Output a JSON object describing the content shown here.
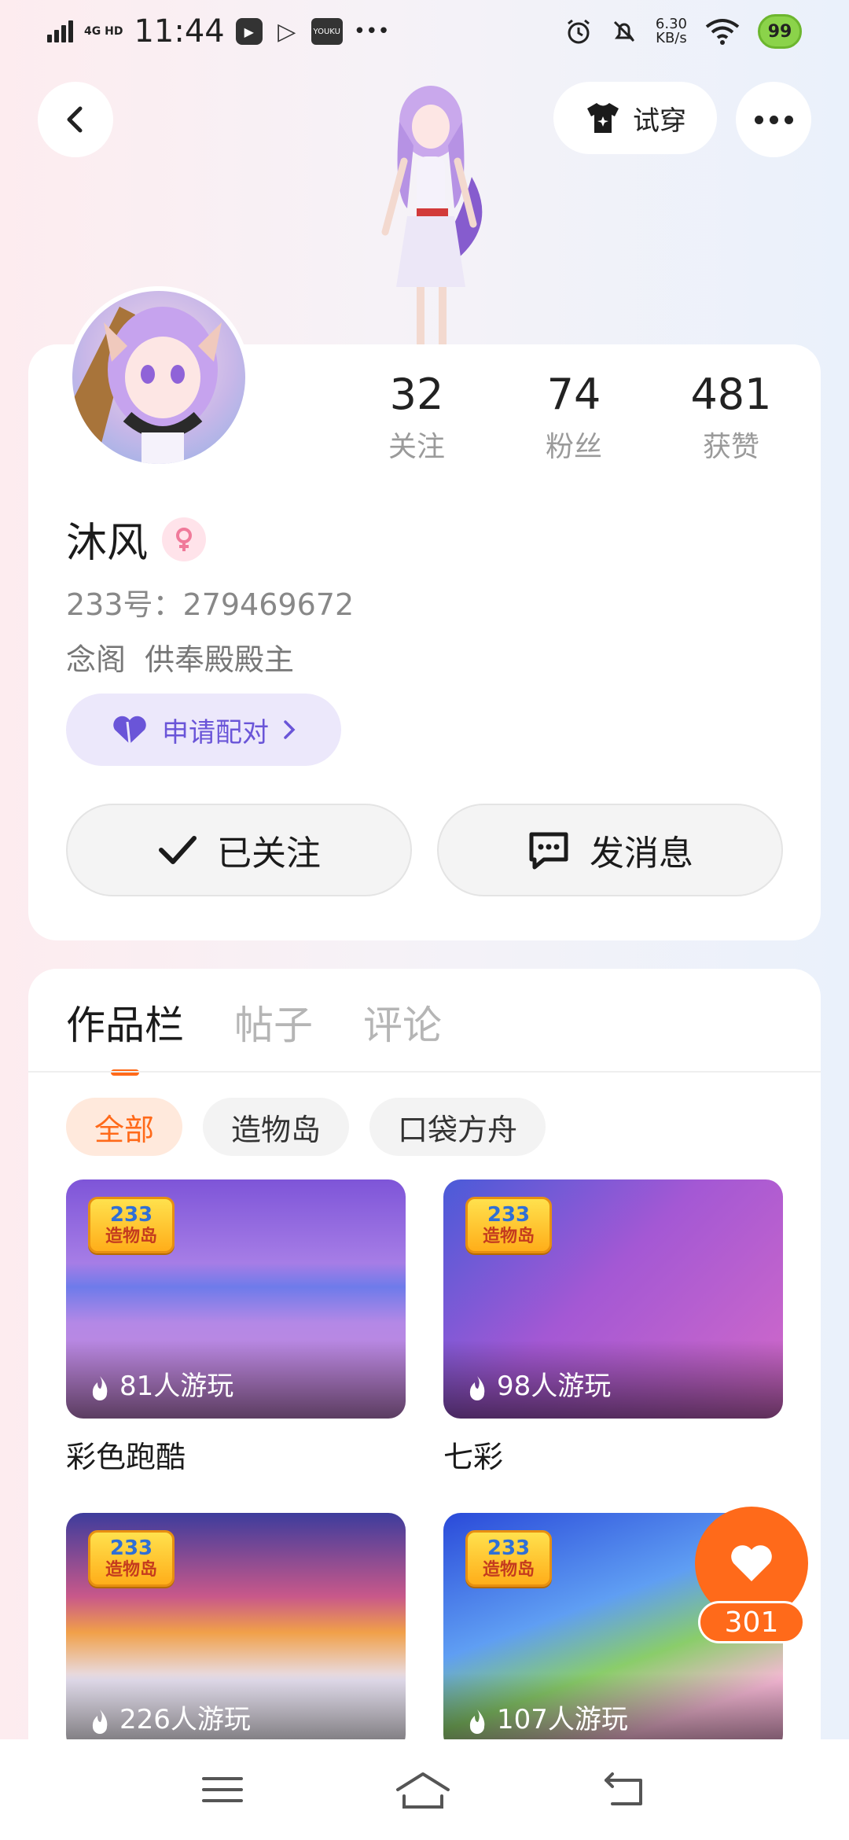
{
  "status_bar": {
    "network": "4G HD",
    "time": "11:44",
    "app_badge": "YOUKU",
    "overflow": "•••",
    "speed_value": "6.30",
    "speed_unit": "KB/s",
    "battery": "99"
  },
  "header": {
    "tryon_label": "试穿"
  },
  "profile": {
    "stats": [
      {
        "value": "32",
        "label": "关注"
      },
      {
        "value": "74",
        "label": "粉丝"
      },
      {
        "value": "481",
        "label": "获赞"
      }
    ],
    "name": "沐风",
    "uid": "233号：279469672",
    "bio": [
      "念阁",
      "供奉殿殿主"
    ],
    "pair_label": "申请配对",
    "follow_label": "已关注",
    "message_label": "发消息"
  },
  "works": {
    "tabs": [
      "作品栏",
      "帖子",
      "评论"
    ],
    "chips": [
      "全部",
      "造物岛",
      "口袋方舟"
    ],
    "logo_line1": "233",
    "logo_line2": "造物岛",
    "games": [
      {
        "plays": "81人游玩",
        "title": "彩色跑酷"
      },
      {
        "plays": "98人游玩",
        "title": "七彩"
      },
      {
        "plays": "226人游玩",
        "title": ""
      },
      {
        "plays": "107人游玩",
        "title": ""
      }
    ]
  },
  "like_count": "301",
  "colors": {
    "accent": "#ff6a1a",
    "pair_purple": "#6a55d8"
  }
}
